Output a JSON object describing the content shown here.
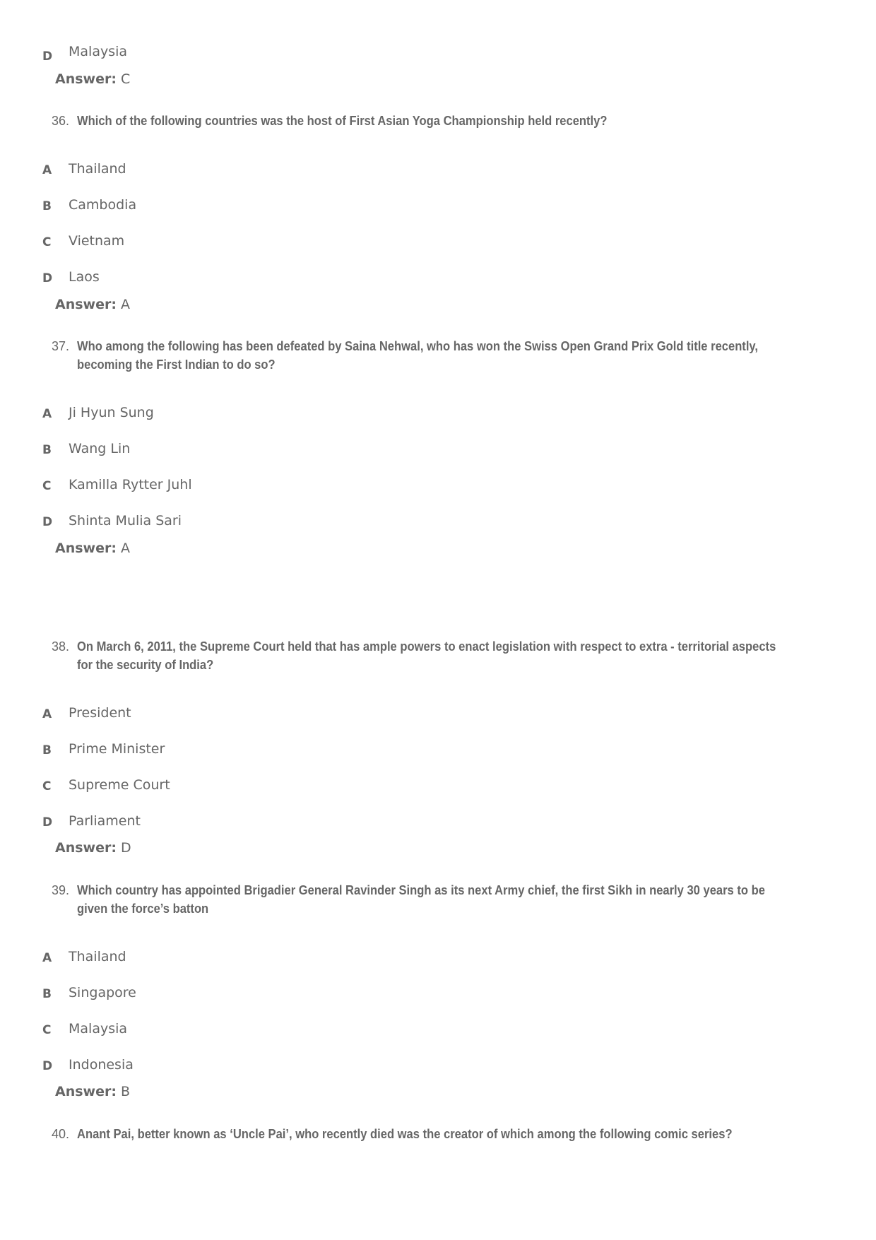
{
  "prev_question_tail": {
    "option": {
      "letter": "D",
      "text": "Malaysia"
    },
    "answer_label": "Answer:",
    "answer": "C"
  },
  "questions": [
    {
      "number": "36.",
      "text": "Which of the following countries was the host of First Asian Yoga Championship held recently?",
      "options": [
        {
          "letter": "A",
          "text": "Thailand"
        },
        {
          "letter": "B",
          "text": "Cambodia"
        },
        {
          "letter": "C",
          "text": "Vietnam"
        },
        {
          "letter": "D",
          "text": "Laos"
        }
      ],
      "answer_label": "Answer:",
      "answer": "A"
    },
    {
      "number": "37.",
      "text_lines": [
        "Who among the following has been defeated by Saina Nehwal, who has won the Swiss Open Grand Prix Gold title recently,",
        "becoming the First Indian to do so?"
      ],
      "options": [
        {
          "letter": "A",
          "text": "Ji Hyun Sung"
        },
        {
          "letter": "B",
          "text": "Wang Lin"
        },
        {
          "letter": "C",
          "text": "Kamilla Rytter Juhl"
        },
        {
          "letter": "D",
          "text": "Shinta Mulia Sari"
        }
      ],
      "answer_label": "Answer:",
      "answer": "A"
    },
    {
      "number": "38.",
      "text_lines": [
        "On March 6, 2011, the Supreme Court held that has ample powers to enact legislation with respect to extra - territorial aspects",
        "for the security of India?"
      ],
      "options": [
        {
          "letter": "A",
          "text": "President"
        },
        {
          "letter": "B",
          "text": "Prime Minister"
        },
        {
          "letter": "C",
          "text": "Supreme Court"
        },
        {
          "letter": "D",
          "text": "Parliament"
        }
      ],
      "answer_label": "Answer:",
      "answer": "D"
    },
    {
      "number": "39.",
      "text_lines": [
        "Which country has appointed Brigadier General Ravinder Singh as its next Army chief, the first Sikh in nearly 30 years to be",
        "given the force’s batton"
      ],
      "options": [
        {
          "letter": "A",
          "text": "Thailand"
        },
        {
          "letter": "B",
          "text": "Singapore"
        },
        {
          "letter": "C",
          "text": "Malaysia"
        },
        {
          "letter": "D",
          "text": "Indonesia"
        }
      ],
      "answer_label": "Answer:",
      "answer": "B"
    },
    {
      "number": "40.",
      "text": "Anant Pai, better known as ‘Uncle Pai’, who recently died was the creator of which among the following comic series?"
    }
  ]
}
